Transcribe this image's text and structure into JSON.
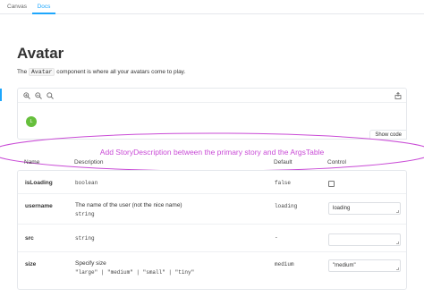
{
  "tabs": [
    {
      "label": "Canvas",
      "active": false
    },
    {
      "label": "Docs",
      "active": true
    }
  ],
  "colors": {
    "accent": "#1ea7fd",
    "annotation": "#c94bd6",
    "avatar": "#66bf3c"
  },
  "page": {
    "title": "Avatar",
    "intro_before": "The ",
    "intro_code": "Avatar",
    "intro_after": " component is where all your avatars come to play."
  },
  "preview": {
    "toolbar_icons": [
      "zoom-in-icon",
      "zoom-out-icon",
      "zoom-reset-icon",
      "share-icon"
    ],
    "avatar_initial": "L",
    "show_code_label": "Show code"
  },
  "annotation": {
    "text": "Add StoryDescription between the primary story and the ArgsTable"
  },
  "args_table": {
    "headers": {
      "name": "Name",
      "description": "Description",
      "default": "Default",
      "control": "Control"
    },
    "rows": [
      {
        "name": "isLoading",
        "description": "",
        "type": "boolean",
        "default": "false",
        "control": "checkbox",
        "value": ""
      },
      {
        "name": "username",
        "description": "The name of the user (not the nice name)",
        "type": "string",
        "default": "loading",
        "control": "text",
        "value": "loading"
      },
      {
        "name": "src",
        "description": "",
        "type": "string",
        "default": "-",
        "control": "text",
        "value": ""
      },
      {
        "name": "size",
        "description": "Specify size",
        "type": "\"large\" | \"medium\" | \"small\" | \"tiny\"",
        "default": "medium",
        "control": "text",
        "value": "\"medium\""
      }
    ]
  }
}
